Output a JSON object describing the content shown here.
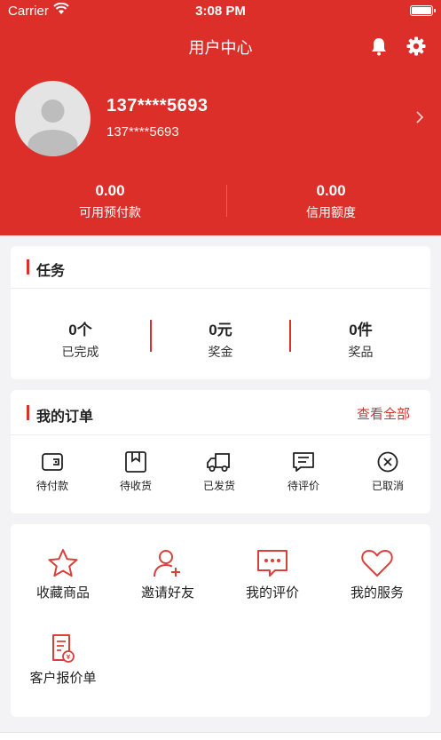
{
  "status_bar": {
    "carrier": "Carrier",
    "time": "3:08 PM"
  },
  "header": {
    "title": "用户中心",
    "username": "137****5693",
    "phone": "137****5693"
  },
  "balances": [
    {
      "value": "0.00",
      "label": "可用预付款"
    },
    {
      "value": "0.00",
      "label": "信用额度"
    }
  ],
  "tasks": {
    "title": "任务",
    "items": [
      {
        "value": "0个",
        "label": "已完成"
      },
      {
        "value": "0元",
        "label": "奖金"
      },
      {
        "value": "0件",
        "label": "奖品"
      }
    ]
  },
  "orders": {
    "title": "我的订单",
    "view_all": "查看全部",
    "items": [
      {
        "label": "待付款",
        "icon": "wallet-icon"
      },
      {
        "label": "待收货",
        "icon": "package-icon"
      },
      {
        "label": "已发货",
        "icon": "truck-icon"
      },
      {
        "label": "待评价",
        "icon": "comment-icon"
      },
      {
        "label": "已取消",
        "icon": "cancel-icon"
      }
    ]
  },
  "services": [
    {
      "label": "收藏商品",
      "icon": "star-icon"
    },
    {
      "label": "邀请好友",
      "icon": "add-user-icon"
    },
    {
      "label": "我的评价",
      "icon": "chat-icon"
    },
    {
      "label": "我的服务",
      "icon": "heart-icon"
    },
    {
      "label": "客户报价单",
      "icon": "quote-document-icon"
    }
  ],
  "colors": {
    "brand": "#dc2f2a",
    "background": "#f3f3f6"
  }
}
